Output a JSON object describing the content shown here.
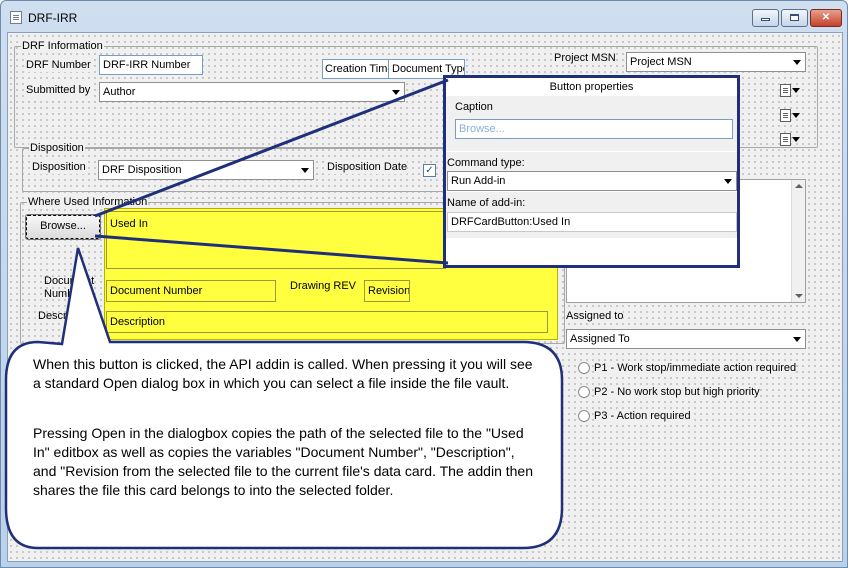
{
  "window": {
    "title": "DRF-IRR"
  },
  "drf_info": {
    "group_title": "DRF Information",
    "drf_number_label": "DRF Number",
    "drf_number_value": "DRF-IRR Number",
    "creation_time_label": "Creation Time",
    "document_type_value": "Document Type",
    "submitted_by_label": "Submitted by",
    "submitted_by_value": "Author",
    "project_msn_label": "Project MSN",
    "project_msn_value": "Project MSN"
  },
  "disposition": {
    "group_title": "Disposition",
    "disposition_label": "Disposition",
    "disposition_value": "DRF Disposition",
    "disposition_date_label": "Disposition Date",
    "checkbox_mark": "✓"
  },
  "where_used": {
    "group_title": "Where Used Information",
    "browse_label": "Browse...",
    "used_in_value": "Used In",
    "document_number_label_line1": "Document",
    "document_number_label_line2": "Number",
    "document_number_value": "Document Number",
    "drawing_rev_label": "Drawing REV",
    "revision_value": "Revision",
    "description_label": "Description",
    "description_value": "Description"
  },
  "assignment": {
    "assigned_to_label": "Assigned to",
    "assigned_to_value": "Assigned To",
    "priorities": [
      "P1 - Work stop/immediate action required",
      "P2 - No work stop but high priority",
      "P3 - Action required"
    ]
  },
  "button_properties": {
    "title": "Button properties",
    "caption_label": "Caption",
    "caption_value": "Browse...",
    "command_type_label": "Command type:",
    "command_type_value": "Run Add-in",
    "addin_name_label": "Name of add-in:",
    "addin_name_value": "DRFCardButton:Used In"
  },
  "callout": {
    "paragraph1": "When this button is clicked, the API addin is called. When pressing it you will see a standard Open dialog box in which you can select a file inside the file vault.",
    "paragraph2": "Pressing Open in the dialogbox copies the path of the selected file to the \"Used In\" editbox as well as copies the variables \"Document Number\", \"Description\", and \"Revision from the selected file to the current file's data card. The addin then shares the file this card belongs to into the selected folder."
  },
  "colors": {
    "highlight_yellow": "#ffff40",
    "callout_border": "#1f2f7a",
    "dialog_border": "#1f2f7a"
  },
  "icons": [
    "app-icon",
    "minimize-icon",
    "maximize-icon",
    "close-icon",
    "dropdown-arrow-icon",
    "document-icon",
    "checkbox-icon",
    "radio-icon"
  ]
}
